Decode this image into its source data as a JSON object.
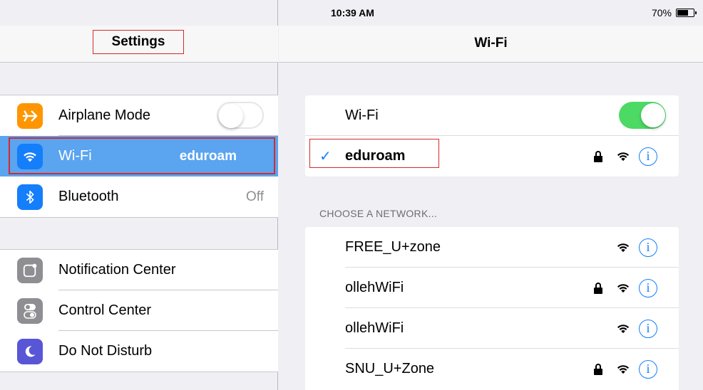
{
  "status_bar": {
    "device": "iPad",
    "time": "10:39 AM",
    "battery": "70%",
    "battery_level": 0.7
  },
  "left": {
    "title": "Settings",
    "group1": [
      {
        "label": "Airplane Mode",
        "icon": "airplane-icon",
        "color": "#ff9500"
      },
      {
        "label": "Wi-Fi",
        "detail": "eduroam",
        "icon": "wifi-icon",
        "color": "#157efb"
      },
      {
        "label": "Bluetooth",
        "detail": "Off",
        "icon": "bluetooth-icon",
        "color": "#157efb"
      }
    ],
    "group2": [
      {
        "label": "Notification Center",
        "icon": "notification-center-icon",
        "color": "#8e8e93"
      },
      {
        "label": "Control Center",
        "icon": "control-center-icon",
        "color": "#8e8e93"
      },
      {
        "label": "Do Not Disturb",
        "icon": "moon-icon",
        "color": "#5856d6"
      }
    ]
  },
  "right": {
    "title": "Wi-Fi",
    "wifi_label": "Wi-Fi",
    "connected": "eduroam",
    "section_header": "CHOOSE A NETWORK...",
    "networks": [
      {
        "name": "FREE_U+zone",
        "locked": false
      },
      {
        "name": "ollehWiFi",
        "locked": true
      },
      {
        "name": "ollehWiFi",
        "locked": false
      },
      {
        "name": "SNU_U+Zone",
        "locked": true
      }
    ],
    "info_glyph": "i",
    "check_glyph": "✓"
  },
  "colors": {
    "toggle_on": "#4cd964",
    "selection": "#5aa4f0",
    "accent": "#157efb",
    "highlight_box": "#d32b2b"
  }
}
